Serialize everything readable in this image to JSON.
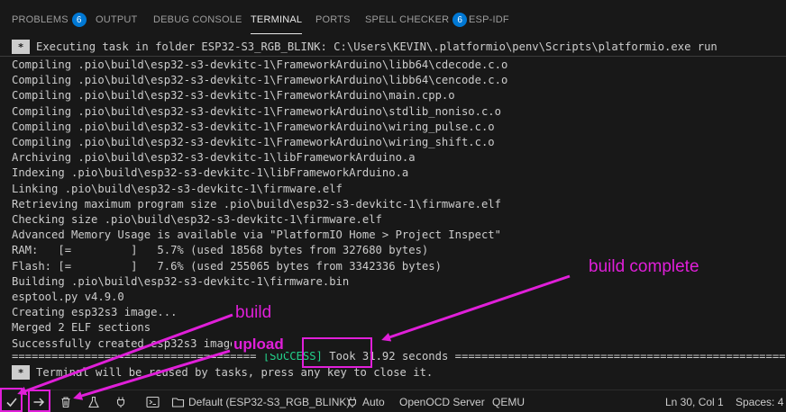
{
  "colors": {
    "accent": "#e01fd9",
    "badge": "#0078d4",
    "success": "#23d18b"
  },
  "panel": {
    "tabs": [
      {
        "label": "PROBLEMS",
        "badge": "6"
      },
      {
        "label": "OUTPUT"
      },
      {
        "label": "DEBUG CONSOLE"
      },
      {
        "label": "TERMINAL",
        "active": true
      },
      {
        "label": "PORTS"
      },
      {
        "label": "SPELL CHECKER",
        "badge": "6"
      },
      {
        "label": "ESP-IDF"
      }
    ]
  },
  "terminal": {
    "exec_text": "Executing task in folder ESP32-S3_RGB_BLINK: C:\\Users\\KEVIN\\.platformio\\penv\\Scripts\\platformio.exe run",
    "lines": [
      "Compiling .pio\\build\\esp32-s3-devkitc-1\\FrameworkArduino\\libb64\\cdecode.c.o",
      "Compiling .pio\\build\\esp32-s3-devkitc-1\\FrameworkArduino\\libb64\\cencode.c.o",
      "Compiling .pio\\build\\esp32-s3-devkitc-1\\FrameworkArduino\\main.cpp.o",
      "Compiling .pio\\build\\esp32-s3-devkitc-1\\FrameworkArduino\\stdlib_noniso.c.o",
      "Compiling .pio\\build\\esp32-s3-devkitc-1\\FrameworkArduino\\wiring_pulse.c.o",
      "Compiling .pio\\build\\esp32-s3-devkitc-1\\FrameworkArduino\\wiring_shift.c.o",
      "Archiving .pio\\build\\esp32-s3-devkitc-1\\libFrameworkArduino.a",
      "Indexing .pio\\build\\esp32-s3-devkitc-1\\libFrameworkArduino.a",
      "Linking .pio\\build\\esp32-s3-devkitc-1\\firmware.elf",
      "Retrieving maximum program size .pio\\build\\esp32-s3-devkitc-1\\firmware.elf",
      "Checking size .pio\\build\\esp32-s3-devkitc-1\\firmware.elf",
      "Advanced Memory Usage is available via \"PlatformIO Home > Project Inspect\"",
      "RAM:   [=         ]   5.7% (used 18568 bytes from 327680 bytes)",
      "Flash: [=         ]   7.6% (used 255065 bytes from 3342336 bytes)",
      "Building .pio\\build\\esp32-s3-devkitc-1\\firmware.bin",
      "esptool.py v4.9.0",
      "Creating esp32s3 image...",
      "Merged 2 ELF sections",
      "Successfully created esp32s3 image."
    ],
    "result_prefix": "=====================================",
    "result_status": "[SUCCESS]",
    "result_suffix": " Took 31.92 seconds ===================================================",
    "reuse_text": "Terminal will be reused by tasks, press any key to close it."
  },
  "annotations": {
    "build_complete": "build complete",
    "build": "build",
    "upload": "upload"
  },
  "statusbar": {
    "env": "Default (ESP32-S3_RGB_BLINK)",
    "auto": "Auto",
    "openocd": "OpenOCD Server",
    "qemu": "QEMU",
    "position": "Ln 30, Col 1",
    "spaces": "Spaces: 4"
  }
}
